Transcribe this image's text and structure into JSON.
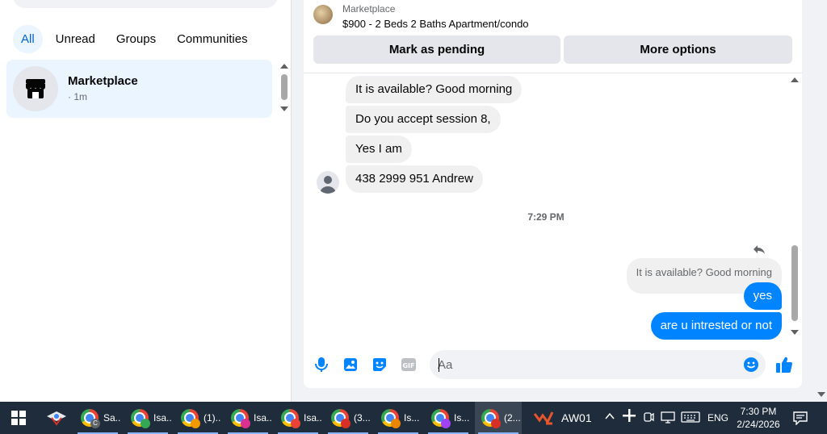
{
  "sidebar": {
    "filters": [
      "All",
      "Unread",
      "Groups",
      "Communities"
    ],
    "active_filter": "All",
    "conversation": {
      "title": "Marketplace",
      "time": "· 1m"
    }
  },
  "chat": {
    "header": {
      "subtitle": "Marketplace",
      "title": "$900 - 2 Beds 2 Baths Apartment/condo",
      "pending_button": "Mark as pending",
      "more_button": "More options"
    },
    "incoming": [
      "It is available? Good morning",
      "Do you accept session 8,",
      "Yes I am",
      "438 2999 951 Andrew"
    ],
    "timestamp": "7:29 PM",
    "reply_quote": "It is available? Good morning",
    "outgoing": [
      "yes",
      "are u intrested or not"
    ],
    "composer": {
      "placeholder": "Aa"
    },
    "colors": {
      "outgoing_bubble": "#0084ff",
      "incoming_bubble": "#f0f0f0",
      "accent": "#0084ff"
    }
  },
  "taskbar": {
    "items": [
      {
        "label": "Sa...",
        "badge": "C",
        "badge_color": "#5f6368"
      },
      {
        "label": "Isa...",
        "badge": "",
        "badge_color": "#34a853"
      },
      {
        "label": "(1)...",
        "badge": "",
        "badge_color": "#f29900"
      },
      {
        "label": "Isa...",
        "badge": "",
        "badge_color": "#d93092"
      },
      {
        "label": "Isa...",
        "badge": "",
        "badge_color": "#ea4335"
      },
      {
        "label": "(3...",
        "badge": "",
        "badge_color": "#d93025"
      },
      {
        "label": "Is...",
        "badge": "",
        "badge_color": "#ea8600"
      },
      {
        "label": "Is...",
        "badge": "",
        "badge_color": "#a142f4"
      },
      {
        "label": "(2...",
        "badge": "",
        "badge_color": "#d93025"
      }
    ],
    "active_index": 8,
    "app_label": "AW01",
    "language": "ENG",
    "time": "7:30 PM",
    "date": "2/24/2026"
  }
}
